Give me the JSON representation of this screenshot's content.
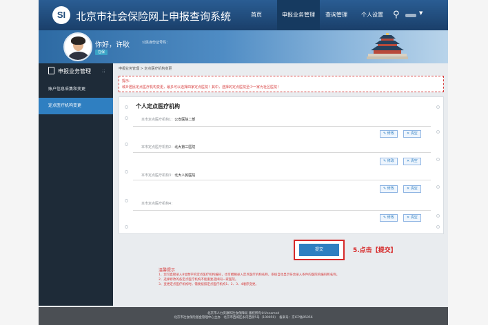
{
  "app": {
    "title": "北京市社会保险网上申报查询系统"
  },
  "nav": [
    {
      "label": "首页"
    },
    {
      "label": "申报业务管理"
    },
    {
      "label": "查询管理"
    },
    {
      "label": "个人设置"
    }
  ],
  "banner": {
    "greeting": "你好，许耿",
    "id_label": "公民身份证号码：",
    "badge": "在保"
  },
  "sidebar": {
    "heading": "申报业务管理",
    "items": [
      {
        "label": "账户信息采集和变更"
      },
      {
        "label": "定点医疗机构变更"
      }
    ]
  },
  "breadcrumb": "申报业务管理 > 定点医疗机构变更",
  "tip": {
    "title": "提示：",
    "text": "城乡居民定点医疗机构变更，最多可以选择四家定点医院！其中，选择的定点医院至少一家为社区医院！"
  },
  "panel": {
    "title": "个人定点医疗机构",
    "institutions": [
      {
        "label": "本市定点医疗机构1：",
        "value": "公安医院二部"
      },
      {
        "label": "本市定点医疗机构2：",
        "value": "北大第三医院"
      },
      {
        "label": "本市定点医疗机构3：",
        "value": "北大人民医院"
      },
      {
        "label": "本市定点医疗机构4：",
        "value": ""
      }
    ],
    "edit_label": "✎ 修改",
    "clear_label": "✕ 清空"
  },
  "submit_label": "提交",
  "annotation": "5.点击【提交】",
  "notes": {
    "heading": "温馨提示",
    "lines": [
      "1、您可直接录入8位数字的定点医疗机构编码，也可模糊录入定点医疗机构名称，系统自动显示符合录入条件的医院的编码和名称。",
      "2、选择修改的各定点医疗机构不能重复选择同一家医院。",
      "3、变更定点医疗机构时，需要按照定点医疗机构1、2、3、4顺序变更。"
    ]
  },
  "footer": {
    "line1": "北京市人力资源和社会保障局 版权所有©Unnamed",
    "line2": "北京市社会保险基金管理中心主办　北京市西城区永内西街5号（100050）　备案号：京ICP备05056"
  },
  "colors": {
    "nav_bg": "#1f4b7a",
    "sidebar_bg": "#1e2b38",
    "accent": "#2f7fc1",
    "alert": "#d63b3b"
  }
}
